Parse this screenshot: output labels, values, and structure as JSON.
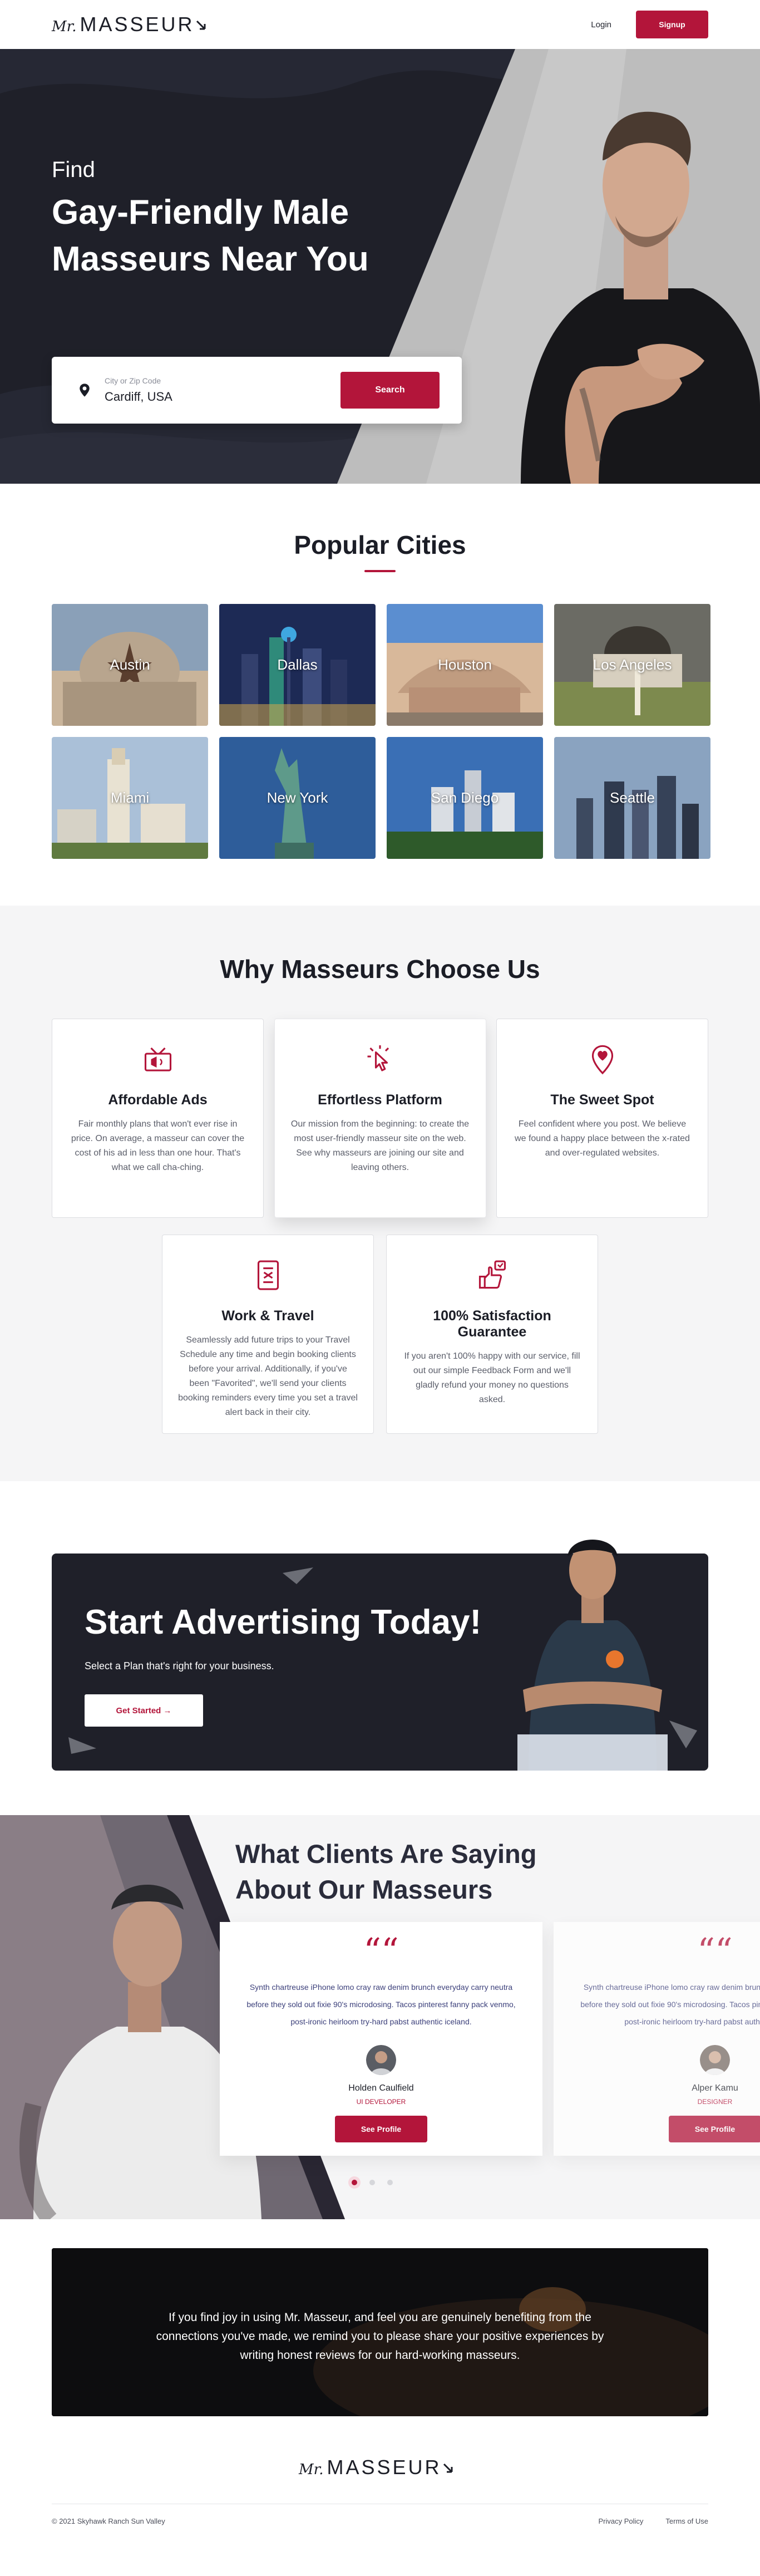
{
  "header": {
    "logo_mr": "Mr.",
    "logo_word": "MASSEUR",
    "login_label": "Login",
    "signup_label": "Signup"
  },
  "hero": {
    "find": "Find",
    "title": "Gay-Friendly Male Masseurs Near You",
    "search": {
      "label": "City or Zip Code",
      "value": "Cardiff, USA",
      "button": "Search"
    }
  },
  "cities": {
    "title": "Popular Cities",
    "items": [
      {
        "name": "Austin"
      },
      {
        "name": "Dallas"
      },
      {
        "name": "Houston"
      },
      {
        "name": "Los Angeles"
      },
      {
        "name": "Miami"
      },
      {
        "name": "New York"
      },
      {
        "name": "San Diego"
      },
      {
        "name": "Seattle"
      }
    ]
  },
  "why": {
    "title": "Why Masseurs Choose Us",
    "cards": [
      {
        "title": "Affordable Ads",
        "text": "Fair monthly plans that won't ever rise in price. On average, a masseur can cover the cost of his ad in less than one hour. That's what we call cha-ching.",
        "icon": "megaphone-icon"
      },
      {
        "title": "Effortless Platform",
        "text": "Our mission from the beginning: to create the most user-friendly masseur site on the web. See why masseurs are joining our site and leaving others.",
        "icon": "pointer-click-icon"
      },
      {
        "title": "The Sweet Spot",
        "text": "Feel confident where you post. We believe we found a happy place between the x-rated and over-regulated websites.",
        "icon": "heart-pin-icon"
      },
      {
        "title": "Work & Travel",
        "text": "Seamlessly add future trips to your Travel Schedule any time and begin booking clients before your arrival. Additionally, if you've been \"Favorited\", we'll send your clients booking reminders every time you set a travel alert back in their city.",
        "icon": "ticket-icon"
      },
      {
        "title": "100% Satisfaction Guarantee",
        "text": "If you aren't 100% happy with our service, fill out our simple Feedback Form and we'll gladly refund your money no questions asked.",
        "icon": "thumbs-up-icon"
      }
    ]
  },
  "advertise": {
    "title": "Start Advertising Today!",
    "subtitle": "Select a Plan that's right for your business.",
    "button": "Get Started"
  },
  "testimonials": {
    "title_line1": "What Clients Are Saying",
    "title_line2": "About Our Masseurs",
    "items": [
      {
        "text": "Synth chartreuse iPhone lomo cray raw denim brunch everyday carry neutra before they sold out fixie 90's microdosing. Tacos pinterest fanny pack venmo, post-ironic heirloom try-hard pabst authentic iceland.",
        "name": "Holden Caulfield",
        "role": "UI DEVELOPER",
        "button": "See Profile"
      },
      {
        "text": "Synth chartreuse iPhone lomo cray raw denim brunch everyday carry neutra before they sold out fixie 90's microdosing. Tacos pinterest fanny pack venmo, post-ironic heirloom try-hard pabst authentic iceland.",
        "name": "Alper Kamu",
        "role": "DESIGNER",
        "button": "See Profile"
      }
    ]
  },
  "note": {
    "text": "If you find joy in using Mr. Masseur, and feel you are genuinely benefiting from the connections you've made, we remind you to please share your positive experiences by writing honest reviews for our hard-working masseurs."
  },
  "footer": {
    "logo_mr": "Mr.",
    "logo_word": "MASSEUR",
    "copyright": "© 2021 Skyhawk Ranch Sun Valley",
    "links": [
      "Privacy Policy",
      "Terms of Use"
    ]
  },
  "colors": {
    "brand_red": "#b3153a",
    "dark": "#1f2029",
    "light_bg": "#f5f5f6"
  }
}
